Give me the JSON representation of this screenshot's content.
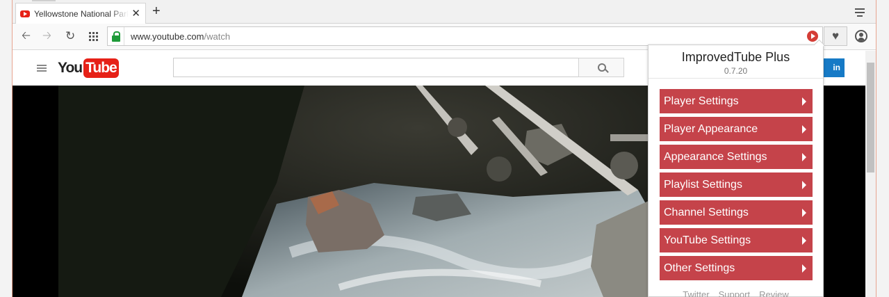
{
  "tab": {
    "title": "Yellowstone National Park",
    "close": "✕"
  },
  "new_tab": "+",
  "address_bar": {
    "url_host": "www.youtube.com",
    "url_path": "/watch"
  },
  "youtube": {
    "logo_you": "You",
    "logo_tube": "Tube",
    "signin_label": "in"
  },
  "popup": {
    "title": "ImprovedTube Plus",
    "version": "0.7.20",
    "menu": [
      {
        "label": "Player Settings"
      },
      {
        "label": "Player Appearance"
      },
      {
        "label": "Appearance Settings"
      },
      {
        "label": "Playlist Settings"
      },
      {
        "label": "Channel Settings"
      },
      {
        "label": "YouTube Settings"
      },
      {
        "label": "Other Settings"
      }
    ],
    "footer": [
      "Twitter",
      "Support",
      "Review"
    ]
  },
  "colors": {
    "menu_red": "#c5434a",
    "youtube_red": "#e62117",
    "signin_blue": "#167ac6"
  }
}
